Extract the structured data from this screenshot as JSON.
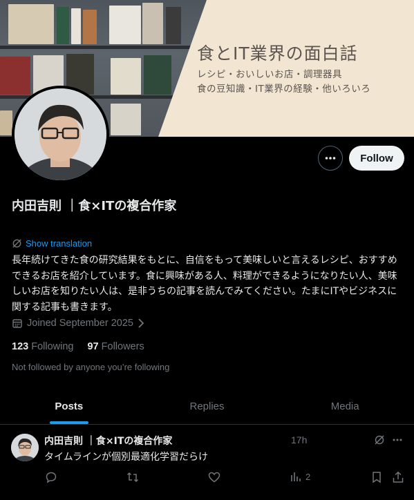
{
  "banner": {
    "title": "食とIT業界の面白話",
    "subtitle_line1": "レシピ・おいしいお店・調理器具",
    "subtitle_line2": "食の豆知識・IT業界の経験・他いろいろ",
    "panel_color": "#f2e6d2"
  },
  "profile": {
    "name": "内田吉則 ｜食×ITの複合作家",
    "follow_label": "Follow",
    "more_icon": "more-horizontal-icon",
    "translate_label": "Show translation",
    "bio": "長年続けてきた食の研究結果をもとに、自信をもって美味しいと言えるレシピ、おすすめできるお店を紹介しています。食に興味がある人、料理ができるようになりたい人、美味しいお店を知りたい人は、是非うちの記事を読んでみてください。たまにITやビジネスに関する記事も書きます。",
    "joined": "Joined September 2025",
    "following_count": "123",
    "following_label": "Following",
    "followers_count": "97",
    "followers_label": "Followers",
    "not_followed": "Not followed by anyone you’re following"
  },
  "tabs": [
    {
      "label": "Posts",
      "active": true
    },
    {
      "label": "Replies",
      "active": false
    },
    {
      "label": "Media",
      "active": false
    }
  ],
  "tweet": {
    "author": "内田吉則 ｜食×ITの複合作家",
    "time": "17h",
    "text": "タイムラインが個別最適化学習だらけ",
    "views": "2"
  },
  "colors": {
    "accent": "#1d9bf0",
    "muted": "#71767b",
    "text": "#e7e9ea",
    "border": "#2f3336"
  }
}
